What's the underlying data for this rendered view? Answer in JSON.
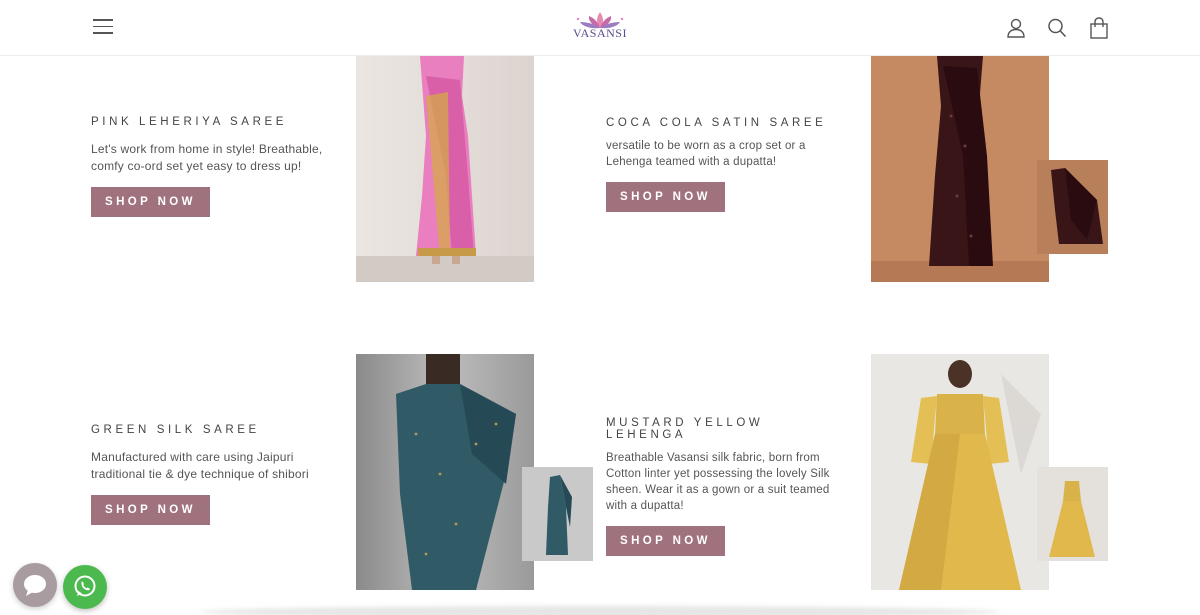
{
  "header": {
    "menu_icon": "hamburger-menu-icon",
    "logo_text": "VASANSI",
    "account_icon": "user-icon",
    "search_icon": "search-icon",
    "cart_icon": "shopping-bag-icon"
  },
  "products": [
    {
      "title": "PINK LEHERIYA SAREE",
      "description": "Let's work from home in style! Breathable, comfy co-ord set yet easy to dress up!",
      "button": "SHOP NOW"
    },
    {
      "title": "COCA COLA SATIN SAREE",
      "description": "versatile to be worn as a crop set or a Lehenga teamed with a dupatta!",
      "button": "SHOP NOW"
    },
    {
      "title": "GREEN SILK SAREE",
      "description": "Manufactured with care using Jaipuri traditional tie & dye technique of shibori",
      "button": "SHOP NOW"
    },
    {
      "title": "MUSTARD YELLOW LEHENGA",
      "description": "Breathable Vasansi silk fabric, born from Cotton linter yet possessing the lovely Silk sheen. Wear it as a gown or a suit teamed with a dupatta!",
      "button": "SHOP NOW"
    }
  ],
  "colors": {
    "button": "#a0727e",
    "whatsapp": "#4cb94f",
    "chat": "#a89ca0"
  },
  "widgets": {
    "chat_icon": "chat-bubble-icon",
    "whatsapp_icon": "whatsapp-icon"
  }
}
